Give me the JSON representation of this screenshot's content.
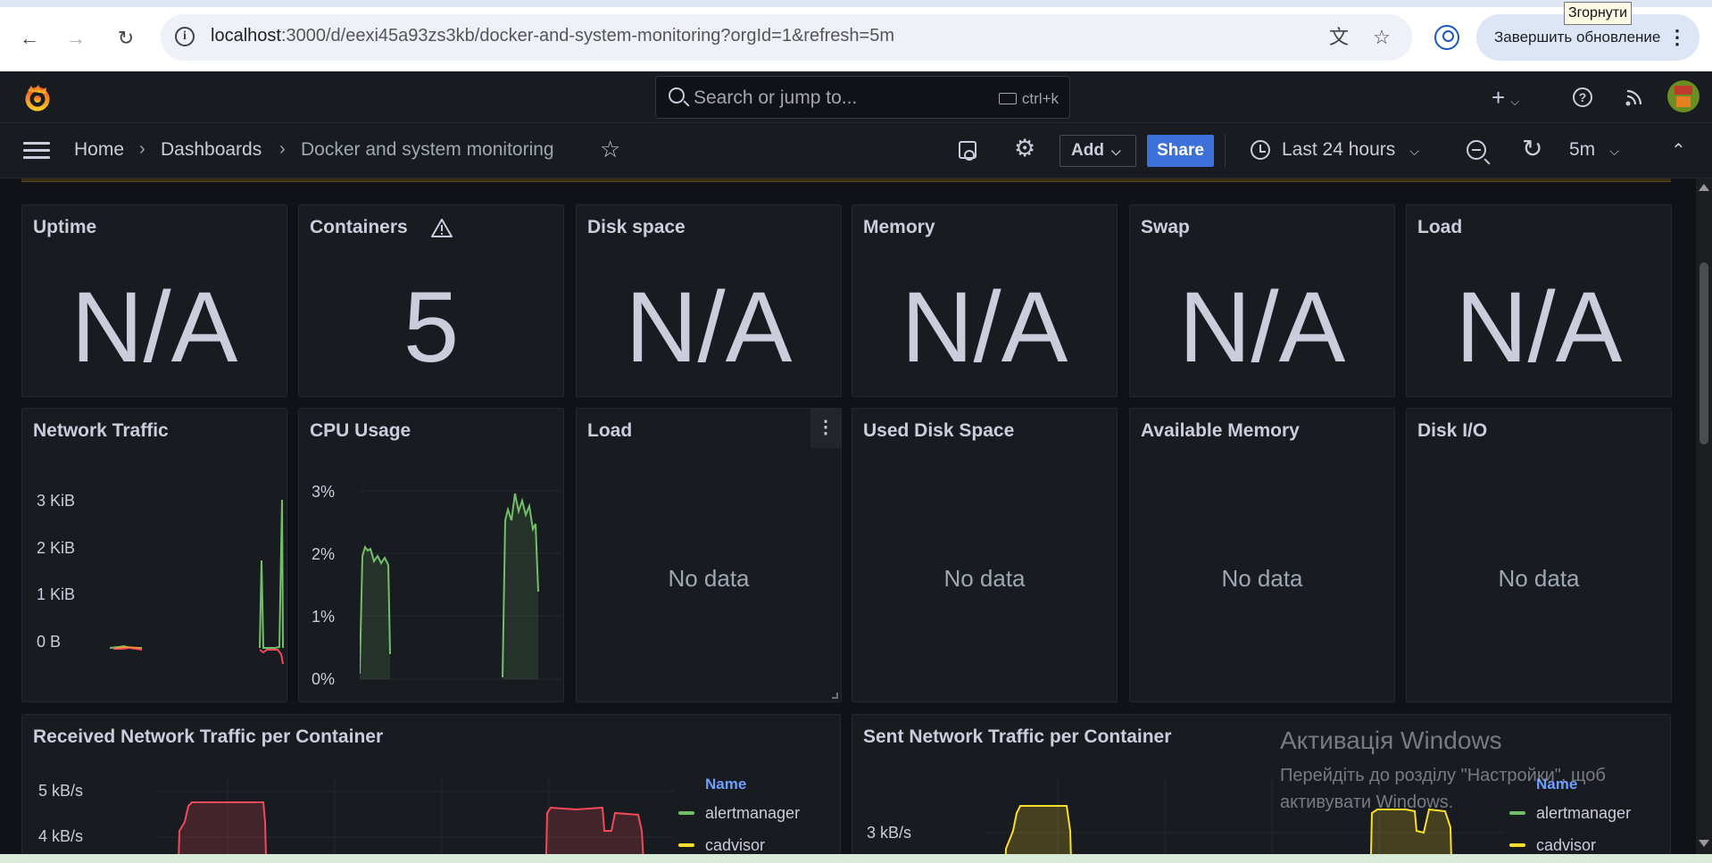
{
  "browser": {
    "url_host": "localhost",
    "url_path": ":3000/d/eexi45a93zs3kb/docker-and-system-monitoring?orgId=1&refresh=5m",
    "update_button": "Завершить обновление",
    "tooltip": "Згорнути"
  },
  "topbar": {
    "search_placeholder": "Search or jump to...",
    "shortcut": "ctrl+k"
  },
  "navbar": {
    "breadcrumbs": [
      "Home",
      "Dashboards",
      "Docker and system monitoring"
    ],
    "add_label": "Add",
    "share_label": "Share",
    "time_range": "Last 24 hours",
    "refresh_interval": "5m"
  },
  "stat_panels": [
    {
      "title": "Uptime",
      "value": "N/A"
    },
    {
      "title": "Containers",
      "value": "5"
    },
    {
      "title": "Disk space",
      "value": "N/A"
    },
    {
      "title": "Memory",
      "value": "N/A"
    },
    {
      "title": "Swap",
      "value": "N/A"
    },
    {
      "title": "Load",
      "value": "N/A"
    }
  ],
  "graph_panels": [
    {
      "title": "Network Traffic"
    },
    {
      "title": "CPU Usage"
    },
    {
      "title": "Load",
      "status": "No data"
    },
    {
      "title": "Used Disk Space",
      "status": "No data"
    },
    {
      "title": "Available Memory",
      "status": "No data"
    },
    {
      "title": "Disk I/O",
      "status": "No data"
    }
  ],
  "network_traffic": {
    "y_ticks": [
      "3 KiB",
      "2 KiB",
      "1 KiB",
      "0 B"
    ],
    "colors": {
      "series_a": "#73bf69",
      "series_b": "#f2495c",
      "series_c": "#ff9830"
    }
  },
  "cpu_usage": {
    "y_ticks": [
      "3%",
      "2%",
      "1%",
      "0%"
    ],
    "color": "#73bf69"
  },
  "received_panel": {
    "title": "Received Network Traffic per Container",
    "y_ticks": [
      "5 kB/s",
      "4 kB/s"
    ],
    "legend_header": "Name",
    "legend": [
      {
        "name": "alertmanager",
        "color": "#73bf69"
      },
      {
        "name": "cadvisor",
        "color": "#fade2a"
      }
    ],
    "series_color": "#f2495c"
  },
  "sent_panel": {
    "title": "Sent Network Traffic per Container",
    "y_ticks": [
      "3 kB/s"
    ],
    "legend_header": "Name",
    "legend": [
      {
        "name": "alertmanager",
        "color": "#73bf69"
      },
      {
        "name": "cadvisor",
        "color": "#fade2a"
      }
    ],
    "series_color": "#fade2a"
  },
  "windows_watermark": {
    "title": "Активація Windows",
    "line1": "Перейдіть до розділу \"Настройки\", щоб",
    "line2": "активувати Windows."
  }
}
